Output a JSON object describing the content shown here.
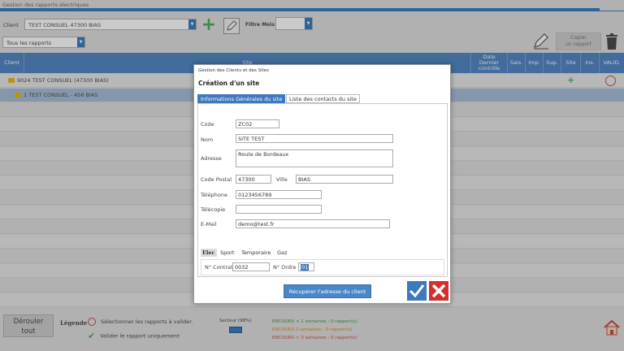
{
  "app": {
    "title": "Gestion des rapports électriques"
  },
  "toolbar": {
    "client_label": "Client",
    "client_value": "TEST CONSUEL 47300 BIAS",
    "filtre_label": "Filtre Mois",
    "filtre_value": "",
    "rapports_value": "Tous les rapports",
    "copy_line1": "Copier",
    "copy_line2": "un rapport"
  },
  "grid": {
    "headers": {
      "client": "Client",
      "site": "Site",
      "date_line1": "Date",
      "date_line2": "Dernier",
      "date_line3": "contrôle",
      "sais": "Sais.",
      "imp": "Imp.",
      "sup": "Sup.",
      "site_col": "Site",
      "ins": "Ins.",
      "valid": "VALID."
    },
    "rows": [
      {
        "text": "9024 TEST CONSUEL (47300 BIAS)"
      },
      {
        "text": "1 TEST CONSUEL - 456 BIAS"
      }
    ]
  },
  "modal": {
    "header": "Gestion des Clients et des Sites",
    "title": "Création d'un site",
    "tabs": {
      "general": "Informations Générales du site",
      "contacts": "Liste des contacts du site"
    },
    "fields": {
      "code_label": "Code",
      "code_value": "ZC02",
      "nom_label": "Nom",
      "nom_value": "SITE TEST",
      "adresse_label": "Adresse",
      "adresse_value": "Route de Bordeaux",
      "cp_label": "Code Postal",
      "cp_value": "47300",
      "ville_label": "Ville",
      "ville_value": "BIAS",
      "tel_label": "Téléphone",
      "tel_value": "0123456789",
      "fax_label": "Télécopie",
      "fax_value": "",
      "email_label": "E-Mail",
      "email_value": "demo@test.fr"
    },
    "subtabs": {
      "elec": "Elec",
      "sport": "Sport",
      "temporaire": "Temporaire",
      "gaz": "Gaz"
    },
    "contrat_label": "N° Contrat",
    "contrat_value": "0032",
    "ordre_label": "N° Ordre",
    "ordre_value": "01",
    "recup_button": "Récupérer l'adresse du client"
  },
  "legend": {
    "derouler_line1": "Dérouler",
    "derouler_line2": "tout",
    "title": "Légende",
    "item1": "Sélectionner les rapports à valider.",
    "item2": "Valider le rapport uniquement",
    "battery": "Secteur (98%)",
    "encours1": "ENCOURS < 1 semaines : 0 rapport(s)",
    "encours2": "ENCOURS 2 semaines : 0 rapport(s)",
    "encours3": "ENCOURS > 3 semaines : 0 rapport(s)"
  },
  "colors": {
    "accent": "#3c79bd",
    "green": "#3aa34a",
    "red": "#d32f2f",
    "encours1": "#2e8b2e",
    "encours2": "#e07b00",
    "encours3": "#c0392b"
  },
  "icons": [
    "plus-icon",
    "edit-icon",
    "pencil-icon",
    "trash-icon",
    "folder-icon",
    "valid-circle-icon",
    "check-icon",
    "battery-icon",
    "home-icon",
    "close-icon"
  ]
}
